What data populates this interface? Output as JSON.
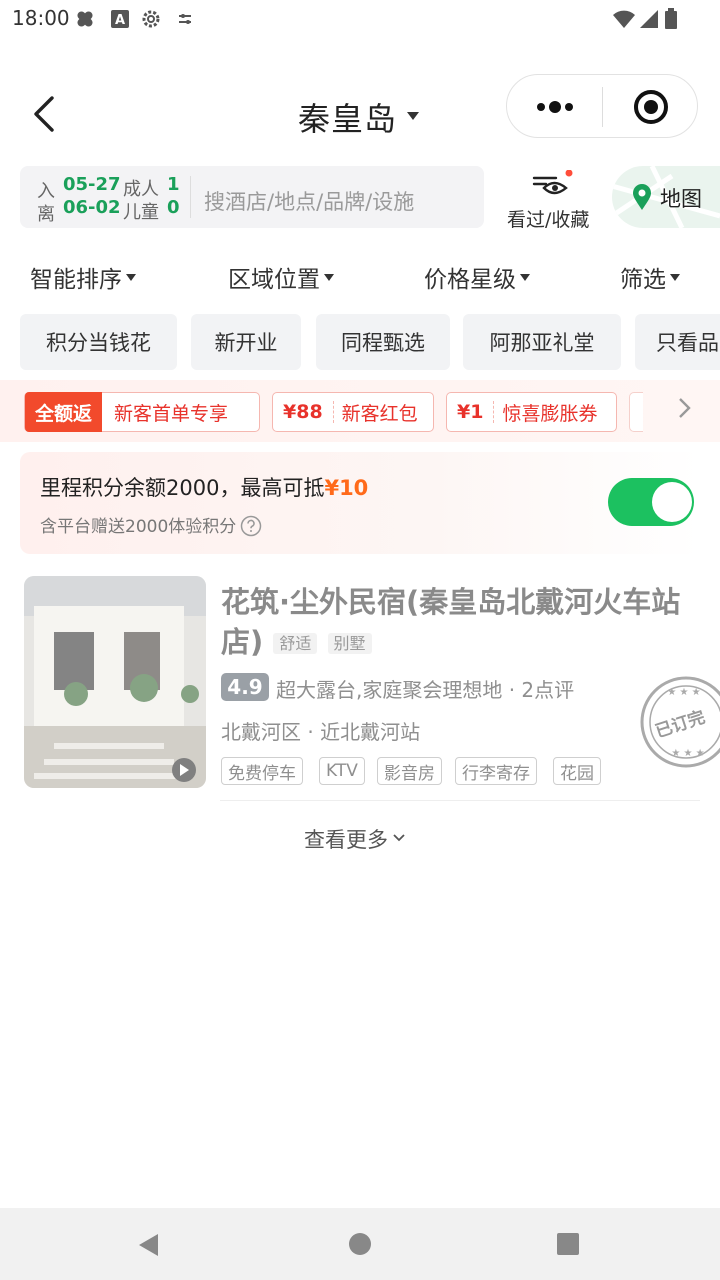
{
  "status_bar": {
    "time": "18:00"
  },
  "header": {
    "title": "秦皇岛"
  },
  "search": {
    "checkin_label": "入",
    "checkin_date": "05-27",
    "checkout_label": "离",
    "checkout_date": "06-02",
    "adults_label": "成人",
    "adults_count": "1",
    "children_label": "儿童",
    "children_count": "0",
    "placeholder": "搜酒店/地点/品牌/设施",
    "seen_label": "看过/收藏",
    "map_label": "地图"
  },
  "sort_tabs": [
    "智能排序",
    "区域位置",
    "价格星级",
    "筛选"
  ],
  "chips": [
    "积分当钱花",
    "新开业",
    "同程甄选",
    "阿那亚礼堂",
    "只看品"
  ],
  "promo": {
    "badge": "全额返",
    "coupons": [
      {
        "amount": "",
        "label": "新客首单专享"
      },
      {
        "amount": "¥88",
        "label": "新客红包"
      },
      {
        "amount": "¥1",
        "label": "惊喜膨胀券"
      }
    ]
  },
  "points": {
    "title_prefix": "里程积分余额2000，最高可抵",
    "title_amount": "¥10",
    "subtitle": "含平台赠送2000体验积分",
    "enabled": true
  },
  "hotel": {
    "name": "花筑·尘外民宿(秦皇岛北戴河火车站店)",
    "tags": [
      "舒适",
      "别墅"
    ],
    "score": "4.9",
    "score_desc": "超大露台,家庭聚会理想地 · 2点评",
    "location": "北戴河区 · 近北戴河站",
    "facilities": [
      "免费停车",
      "KTV",
      "影音房",
      "行李寄存",
      "花园"
    ],
    "stamp_text": "已订完"
  },
  "more_label": "查看更多",
  "colors": {
    "green": "#1aa05a",
    "toggle": "#1cc160",
    "red": "#e8322b",
    "orange": "#ff6a1a"
  }
}
